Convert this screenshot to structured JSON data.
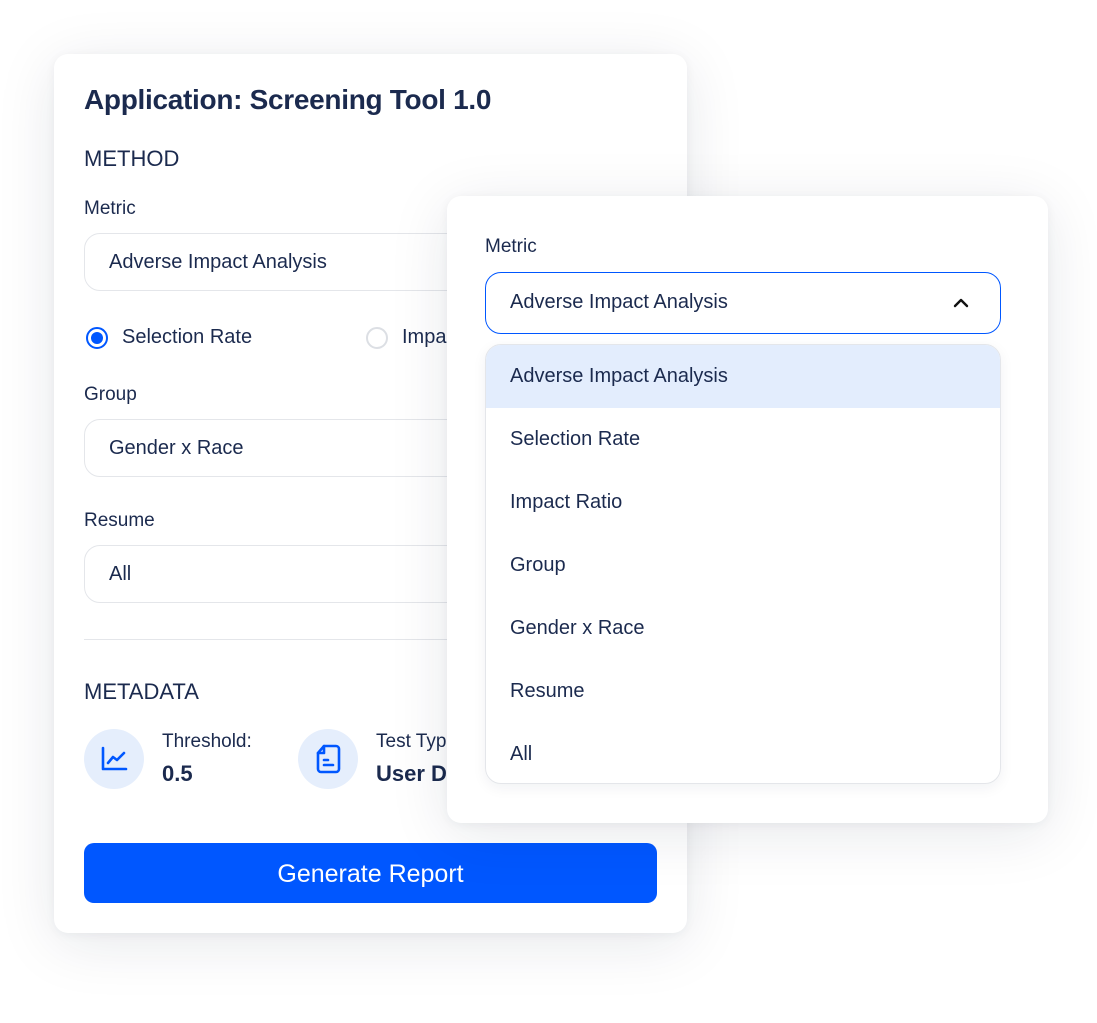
{
  "app": {
    "title": "Application: Screening Tool 1.0"
  },
  "method": {
    "section_title": "METHOD",
    "metric": {
      "label": "Metric",
      "value": "Adverse Impact Analysis"
    },
    "radios": [
      {
        "label": "Selection Rate",
        "checked": true
      },
      {
        "label": "Impact Ratio",
        "visible_text": "Impa",
        "checked": false
      }
    ],
    "group": {
      "label": "Group",
      "value": "Gender x Race"
    },
    "resume": {
      "label": "Resume",
      "value": "All"
    }
  },
  "metadata": {
    "section_title": "METADATA",
    "items": [
      {
        "icon": "line-chart-icon",
        "label": "Threshold:",
        "value": "0.5"
      },
      {
        "icon": "document-icon",
        "label": "Test Typ",
        "value": "User D"
      }
    ]
  },
  "actions": {
    "generate_label": "Generate Report"
  },
  "dropdown": {
    "label": "Metric",
    "selected": "Adverse Impact Analysis",
    "expanded": true,
    "options": [
      "Adverse Impact Analysis",
      "Selection Rate",
      "Impact Ratio",
      "Group",
      "Gender x Race",
      "Resume",
      "All"
    ]
  },
  "colors": {
    "accent": "#0057ff",
    "text": "#1b2a4e",
    "highlight": "#e3edfd",
    "icon_bg": "#e5eefc"
  }
}
